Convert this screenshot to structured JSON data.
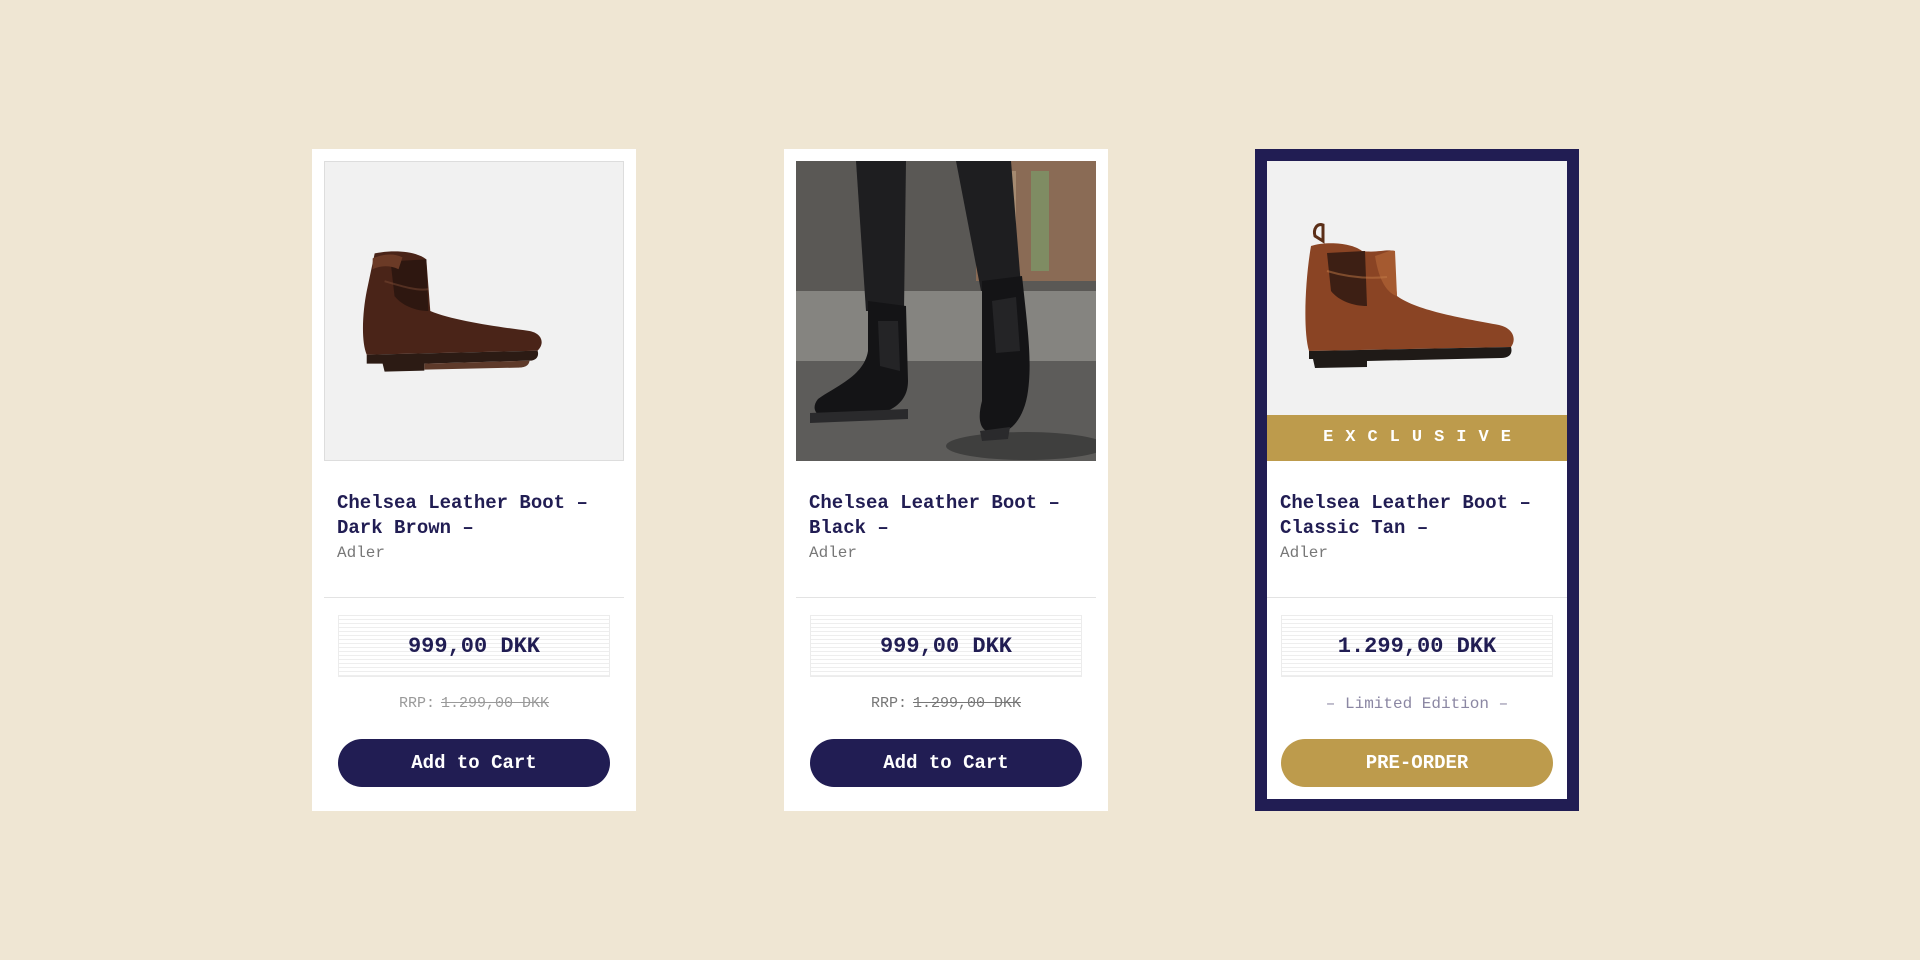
{
  "colors": {
    "background": "#efe6d3",
    "navy": "#211d53",
    "gold": "#bd9b4c",
    "card": "#ffffff"
  },
  "products": [
    {
      "image": "dark-brown-chelsea-boot-photo",
      "title": "Chelsea Leather Boot – Dark Brown –",
      "brand": "Adler",
      "price": "999,00 DKK",
      "rrp_label": "RRP:",
      "rrp_value": "1.299,00 DKK",
      "cta": "Add to Cart"
    },
    {
      "image": "black-chelsea-boots-street-photo",
      "title": "Chelsea Leather Boot – Black –",
      "brand": "Adler",
      "price": "999,00 DKK",
      "rrp_label": "RRP:",
      "rrp_value": "1.299,00 DKK",
      "cta": "Add to Cart"
    },
    {
      "image": "classic-tan-chelsea-boot-photo",
      "badge": "EXCLUSIVE",
      "title": "Chelsea Leather Boot – Classic Tan –",
      "brand": "Adler",
      "price": "1.299,00 DKK",
      "note": "– Limited Edition –",
      "cta": "PRE-ORDER"
    }
  ]
}
